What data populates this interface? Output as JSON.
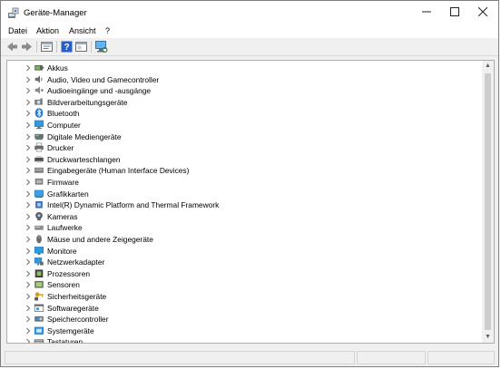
{
  "window": {
    "title": "Geräte-Manager"
  },
  "menu": [
    "Datei",
    "Aktion",
    "Ansicht",
    "?"
  ],
  "toolbar": [
    "back-icon",
    "forward-icon",
    "properties-icon",
    "help-icon",
    "view-icon",
    "monitor-scan-icon"
  ],
  "tree": {
    "items": [
      {
        "label": "Akkus",
        "icon": "battery-icon"
      },
      {
        "label": "Audio, Video und Gamecontroller",
        "icon": "speaker-icon"
      },
      {
        "label": "Audioeingänge und -ausgänge",
        "icon": "audio-io-icon"
      },
      {
        "label": "Bildverarbeitungsgeräte",
        "icon": "camera-device-icon"
      },
      {
        "label": "Bluetooth",
        "icon": "bluetooth-icon"
      },
      {
        "label": "Computer",
        "icon": "computer-icon"
      },
      {
        "label": "Digitale Mediengeräte",
        "icon": "media-device-icon"
      },
      {
        "label": "Drucker",
        "icon": "printer-icon"
      },
      {
        "label": "Druckwarteschlangen",
        "icon": "print-queue-icon"
      },
      {
        "label": "Eingabegeräte (Human Interface Devices)",
        "icon": "hid-icon"
      },
      {
        "label": "Firmware",
        "icon": "firmware-icon"
      },
      {
        "label": "Grafikkarten",
        "icon": "display-adapter-icon"
      },
      {
        "label": "Intel(R) Dynamic Platform and Thermal Framework",
        "icon": "chip-icon"
      },
      {
        "label": "Kameras",
        "icon": "webcam-icon"
      },
      {
        "label": "Laufwerke",
        "icon": "drive-icon"
      },
      {
        "label": "Mäuse und andere Zeigegeräte",
        "icon": "mouse-icon"
      },
      {
        "label": "Monitore",
        "icon": "monitor-icon"
      },
      {
        "label": "Netzwerkadapter",
        "icon": "network-icon"
      },
      {
        "label": "Prozessoren",
        "icon": "processor-icon"
      },
      {
        "label": "Sensoren",
        "icon": "sensor-icon"
      },
      {
        "label": "Sicherheitsgeräte",
        "icon": "security-key-icon"
      },
      {
        "label": "Softwaregeräte",
        "icon": "software-device-icon"
      },
      {
        "label": "Speichercontroller",
        "icon": "storage-controller-icon"
      },
      {
        "label": "Systemgeräte",
        "icon": "system-device-icon"
      },
      {
        "label": "Tastaturen",
        "icon": "keyboard-icon"
      }
    ]
  },
  "colors": {
    "accent": "#0078d7",
    "icon_blue": "#1e90ff",
    "window_bg": "#f0f0f0"
  }
}
